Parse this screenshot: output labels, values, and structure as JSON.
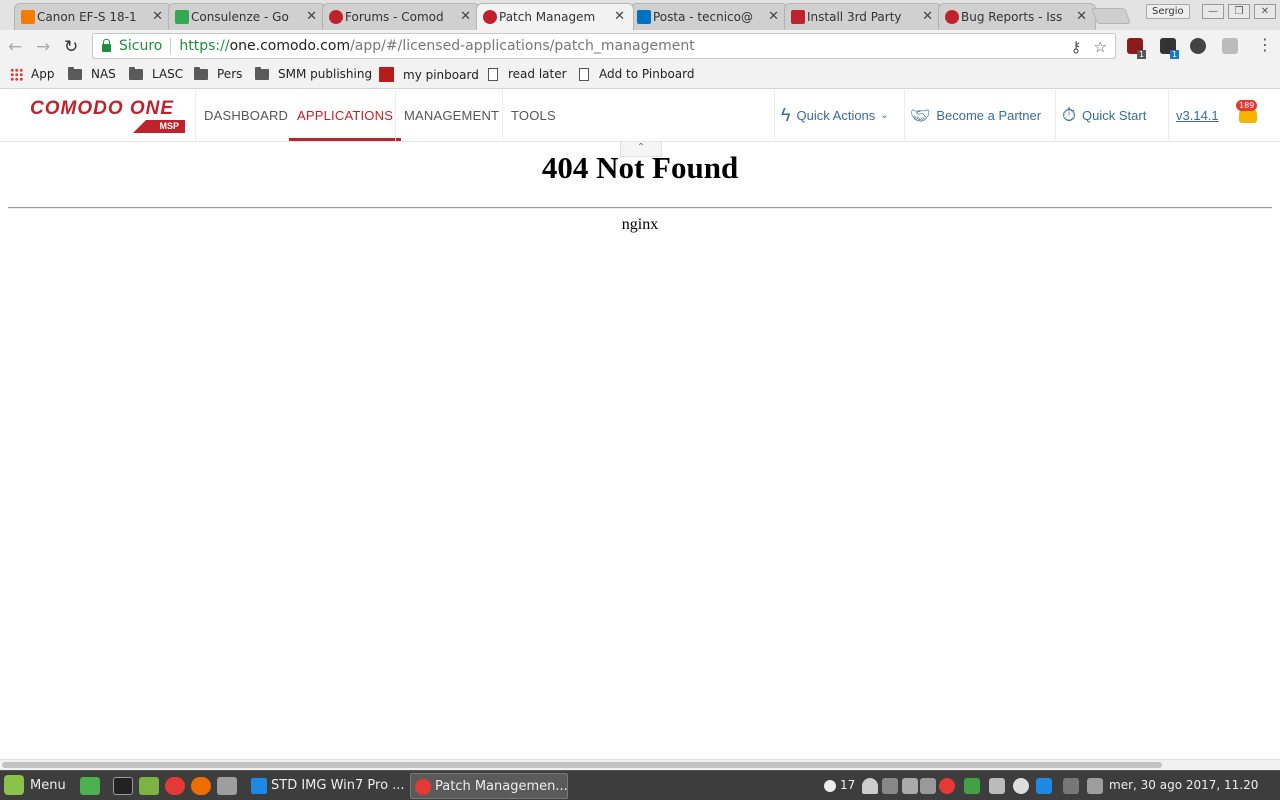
{
  "browser": {
    "tabs": [
      {
        "title": "Canon EF-S 18-1",
        "favicon_color": "#f57c00"
      },
      {
        "title": "Consulenze - Go",
        "favicon_color": "#34a853"
      },
      {
        "title": "Forums - Comod",
        "favicon_color": "#c0222b"
      },
      {
        "title": "Patch Managem",
        "favicon_color": "#c0222b",
        "active": true
      },
      {
        "title": "Posta - tecnico@",
        "favicon_color": "#0072c6"
      },
      {
        "title": "Install 3rd Party",
        "favicon_color": "#c0222b"
      },
      {
        "title": "Bug Reports - Iss",
        "favicon_color": "#c0222b"
      }
    ],
    "tab_close_glyph": "✕",
    "profile_name": "Sergio",
    "window_buttons": [
      "—",
      "❐",
      "✕"
    ],
    "security_label": "Sicuro",
    "url": {
      "scheme": "https://",
      "host": "one.comodo.com",
      "path": "/app/#/licensed-applications/patch_management"
    },
    "extension_badges": [
      "1",
      "1"
    ],
    "bookmarks": [
      {
        "label": "App",
        "icon": "apps-grid-icon"
      },
      {
        "label": "NAS",
        "icon": "folder-icon"
      },
      {
        "label": "LASC",
        "icon": "folder-icon"
      },
      {
        "label": "Pers",
        "icon": "folder-icon"
      },
      {
        "label": "SMM publishing",
        "icon": "folder-icon"
      },
      {
        "label": "my pinboard",
        "icon": "pinboard-icon"
      },
      {
        "label": "read later",
        "icon": "page-icon"
      },
      {
        "label": "Add to Pinboard",
        "icon": "page-icon"
      }
    ]
  },
  "app": {
    "logo_text": "COMODO ONE",
    "logo_sub": "MSP",
    "nav": [
      "DASHBOARD",
      "APPLICATIONS",
      "MANAGEMENT",
      "TOOLS"
    ],
    "active_nav": "APPLICATIONS",
    "quick_actions": "Quick Actions",
    "become_partner": "Become a Partner",
    "quick_start": "Quick Start",
    "version": "v3.14.1",
    "notification_count": "189",
    "accent_color": "#c0222b",
    "link_color": "#3b6b9a"
  },
  "page": {
    "title": "404 Not Found",
    "server": "nginx"
  },
  "taskbar": {
    "menu_label": "Menu",
    "tasks": [
      {
        "label": "STD IMG Win7 Pro ...",
        "active": false
      },
      {
        "label": "Patch Managemen...",
        "active": true
      }
    ],
    "tray_count": "17",
    "clock": "mer, 30 ago 2017,  11.20"
  }
}
